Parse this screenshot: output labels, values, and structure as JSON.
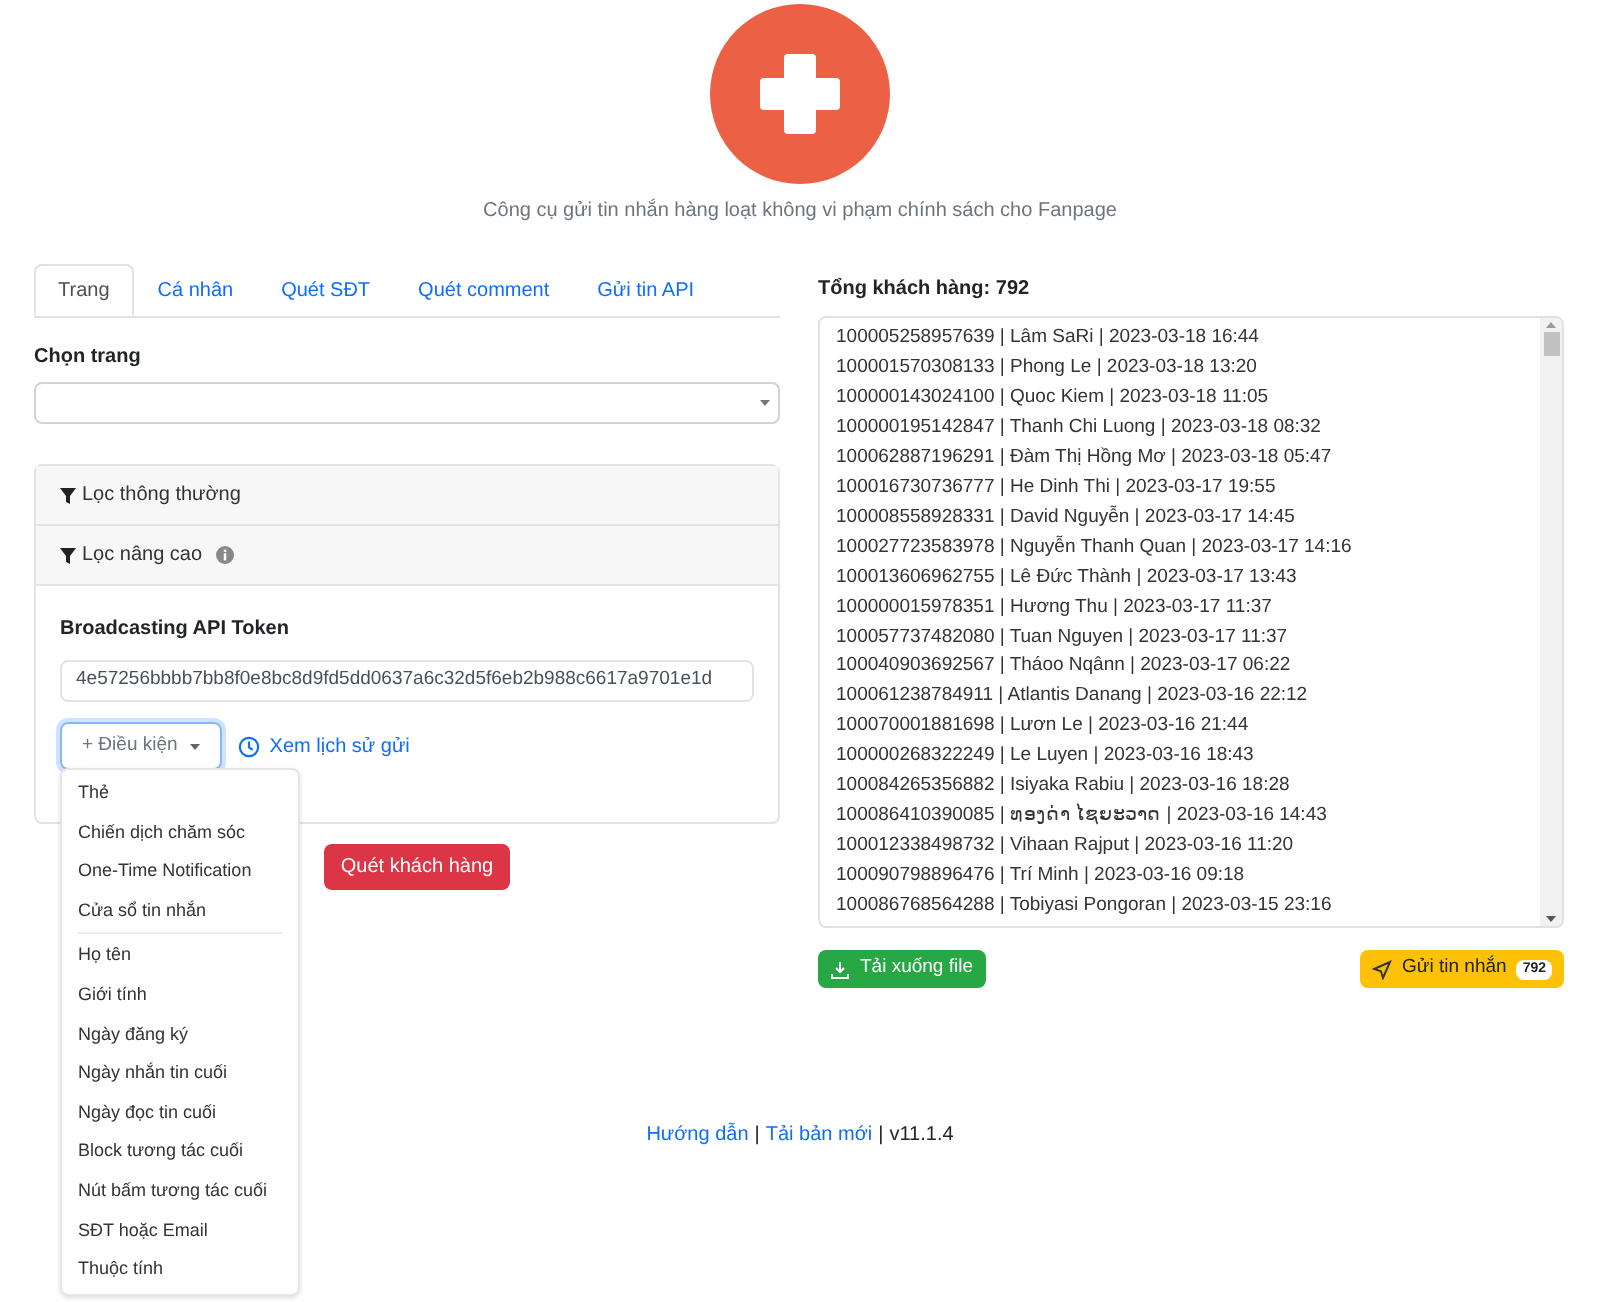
{
  "subtitle": "Công cụ gửi tin nhắn hàng loạt không vi phạm chính sách cho Fanpage",
  "tabs": [
    {
      "label": "Trang",
      "selected": true
    },
    {
      "label": "Cá nhân",
      "selected": false
    },
    {
      "label": "Quét SĐT",
      "selected": false
    },
    {
      "label": "Quét comment",
      "selected": false
    },
    {
      "label": "Gửi tin API",
      "selected": false
    }
  ],
  "page_select": {
    "label": "Chọn trang"
  },
  "filters": [
    {
      "label": "Lọc thông thường",
      "info": false
    },
    {
      "label": "Lọc nâng cao",
      "info": true
    }
  ],
  "token": {
    "label": "Broadcasting API Token",
    "value": "4e57256bbbb7bb8f0e8bc8d9fd5dd0637a6c32d5f6eb2b988c6617a9701e1d"
  },
  "condition_button": {
    "label": "+ Điều kiện",
    "expanded": true
  },
  "history_link": "Xem lịch sử gửi",
  "condition_menu": [
    [
      "Thẻ",
      "Chiến dịch chăm sóc",
      "One-Time Notification",
      "Cửa sổ tin nhắn"
    ],
    [
      "Họ tên",
      "Giới tính",
      "Ngày đăng ký",
      "Ngày nhắn tin cuối",
      "Ngày đọc tin cuối",
      "Block tương tác cuối",
      "Nút bấm tương tác cuối",
      "SĐT hoặc Email",
      "Thuộc tính"
    ]
  ],
  "scan_button": "Quét khách hàng",
  "customers": {
    "title": "Tổng khách hàng: 792",
    "rows": [
      "100005258957639 | Lâm SaRi | 2023-03-18 16:44",
      "100001570308133 | Phong Le | 2023-03-18 13:20",
      "100000143024100 | Quoc Kiem | 2023-03-18 11:05",
      "100000195142847 | Thanh Chi Luong | 2023-03-18 08:32",
      "100062887196291 | Đàm Thị Hồng Mơ | 2023-03-18 05:47",
      "100016730736777 | He Dinh Thi | 2023-03-17 19:55",
      "100008558928331 | David Nguyễn | 2023-03-17 14:45",
      "100027723583978 | Nguyễn Thanh Quan | 2023-03-17 14:16",
      "100013606962755 | Lê Đức Thành | 2023-03-17 13:43",
      "100000015978351 | Hương Thu | 2023-03-17 11:37",
      "100057737482080 | Tuan Nguyen | 2023-03-17 11:37",
      "100040903692567 | Tháoo Nqânn | 2023-03-17 06:22",
      "100061238784911 | Atlantis Danang | 2023-03-16 22:12",
      "100070001881698 | Lươn Le | 2023-03-16 21:44",
      "100000268322249 | Le Luyen | 2023-03-16 18:43",
      "100084265356882 | Isiyaka Rabiu | 2023-03-16 18:28",
      "100086410390085 | ທອງດ່າ ໄຊຍະວາດ | 2023-03-16 14:43",
      "100012338498732 | Vihaan Rajput | 2023-03-16 11:20",
      "100090798896476 | Trí Minh | 2023-03-16 09:18",
      "100086768564288 | Tobiyasi Pongoran | 2023-03-15 23:16"
    ]
  },
  "download_button": "Tải xuống file",
  "send_button": {
    "label": "Gửi tin nhắn",
    "count": "792"
  },
  "footer": [
    {
      "kind": "link",
      "text": "Hướng dẫn"
    },
    {
      "kind": "separator",
      "text": "|"
    },
    {
      "kind": "link",
      "text": "Tải bản mới"
    },
    {
      "kind": "separator",
      "text": "|"
    },
    {
      "kind": "version",
      "text": "v11.1.4"
    }
  ]
}
